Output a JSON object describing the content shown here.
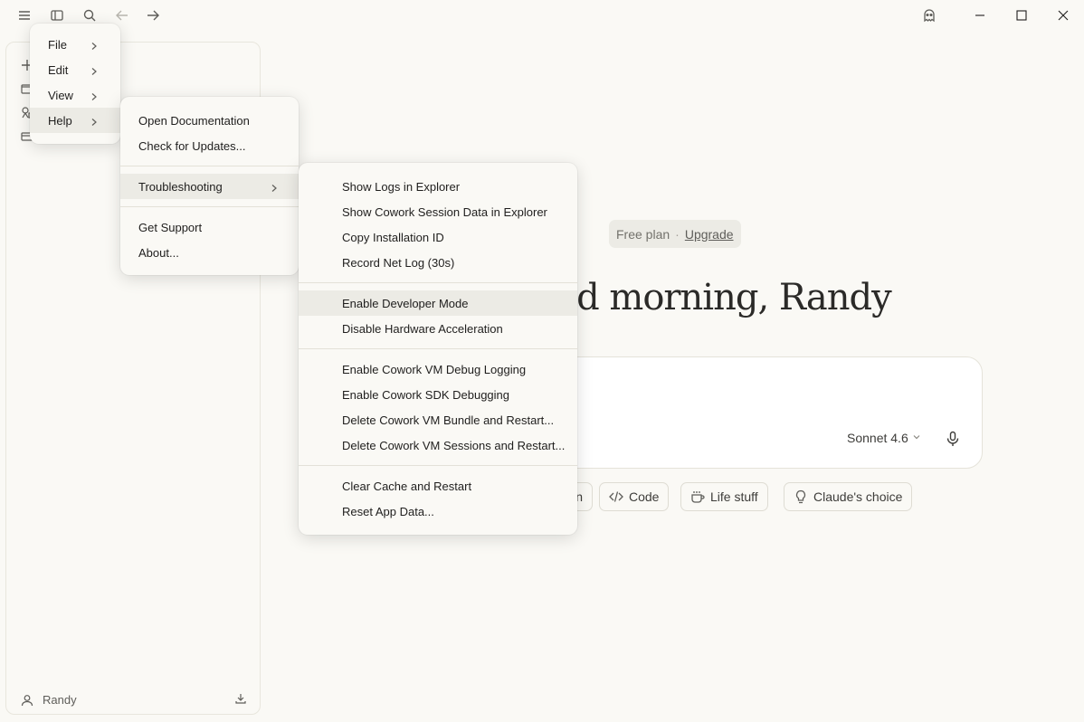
{
  "user": {
    "name": "Randy"
  },
  "main": {
    "plan_label": "Free plan",
    "plan_separator": "·",
    "upgrade_label": "Upgrade",
    "greeting_visible": "od morning, Randy",
    "model_label": "Sonnet 4.6",
    "chips": [
      {
        "label": "n",
        "icon": "pen-icon"
      },
      {
        "label": "Code",
        "icon": "code-icon"
      },
      {
        "label": "Life stuff",
        "icon": "coffee-icon"
      },
      {
        "label": "Claude's choice",
        "icon": "lightbulb-icon"
      }
    ]
  },
  "app_menu": {
    "items": [
      {
        "label": "File"
      },
      {
        "label": "Edit"
      },
      {
        "label": "View"
      },
      {
        "label": "Help"
      }
    ]
  },
  "help_menu": {
    "items": [
      {
        "label": "Open Documentation"
      },
      {
        "label": "Check for Updates..."
      },
      {
        "label": "Troubleshooting"
      },
      {
        "label": "Get Support"
      },
      {
        "label": "About..."
      }
    ]
  },
  "troubleshooting_menu": {
    "items": [
      {
        "label": "Show Logs in Explorer"
      },
      {
        "label": "Show Cowork Session Data in Explorer"
      },
      {
        "label": "Copy Installation ID"
      },
      {
        "label": "Record Net Log (30s)"
      },
      {
        "label": "Enable Developer Mode"
      },
      {
        "label": "Disable Hardware Acceleration"
      },
      {
        "label": "Enable Cowork VM Debug Logging"
      },
      {
        "label": "Enable Cowork SDK Debugging"
      },
      {
        "label": "Delete Cowork VM Bundle and Restart..."
      },
      {
        "label": "Delete Cowork VM Sessions and Restart..."
      },
      {
        "label": "Clear Cache and Restart"
      },
      {
        "label": "Reset App Data..."
      }
    ]
  },
  "colors": {
    "background": "#faf9f5",
    "menu_highlight": "#ecebe5",
    "text": "#1f1e1d"
  }
}
